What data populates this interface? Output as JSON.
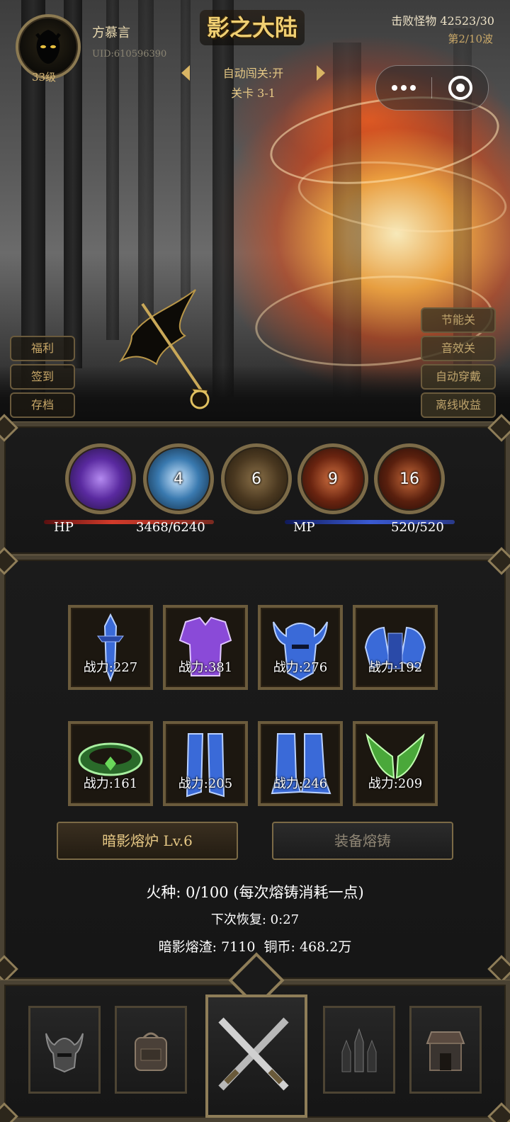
{
  "player": {
    "name": "方慕言",
    "uid": "UID:610596390",
    "level": "33级"
  },
  "game_title": "影之大陆",
  "battle": {
    "kills": "击败怪物 42523/30",
    "wave": "第2/10波",
    "auto_label": "自动闯关:开",
    "stage": "关卡 3-1"
  },
  "left_buttons": [
    "福利",
    "签到",
    "存档"
  ],
  "right_buttons": [
    "节能关",
    "音效关",
    "自动穿戴",
    "离线收益"
  ],
  "skills": [
    {
      "level": "",
      "element": "雷",
      "color": "#6a3aa8"
    },
    {
      "level": "4",
      "element": "冰",
      "color": "#2a6a9a"
    },
    {
      "level": "6",
      "element": "土",
      "color": "#6a5030"
    },
    {
      "level": "9",
      "element": "火",
      "color": "#7a2a18"
    },
    {
      "level": "16",
      "element": "火",
      "color": "#6a2410"
    }
  ],
  "stats": {
    "hp_label": "HP",
    "hp_value": "3468/6240",
    "hp_ratio": 0.556,
    "mp_label": "MP",
    "mp_value": "520/520",
    "mp_ratio": 1.0
  },
  "equipment": [
    {
      "icon": "sword-icon",
      "power": "战力:227",
      "color": "#3a6ad8"
    },
    {
      "icon": "armor-icon",
      "power": "战力:381",
      "color": "#8a4ad8"
    },
    {
      "icon": "helmet-icon",
      "power": "战力:276",
      "color": "#3a6ad8"
    },
    {
      "icon": "shoulder-icon",
      "power": "战力:192",
      "color": "#3a6ad8"
    },
    {
      "icon": "belt-icon",
      "power": "战力:161",
      "color": "#4aa83a"
    },
    {
      "icon": "greaves-icon",
      "power": "战力:205",
      "color": "#3a6ad8"
    },
    {
      "icon": "boots-icon",
      "power": "战力:246",
      "color": "#3a6ad8"
    },
    {
      "icon": "wings-icon",
      "power": "战力:209",
      "color": "#4aa83a"
    }
  ],
  "forge": {
    "furnace_button": "暗影熔炉 Lv.6",
    "forge_button": "装备熔铸",
    "fire": "火种: 0/100 (每次熔铸消耗一点)",
    "recover": "下次恢复: 0:27",
    "currency": "暗影熔渣: 7110  铜币: 468.2万"
  },
  "nav": [
    "helmet-nav-icon",
    "backpack-nav-icon",
    "crossed-swords-nav-icon",
    "castle-nav-icon",
    "shop-nav-icon"
  ]
}
